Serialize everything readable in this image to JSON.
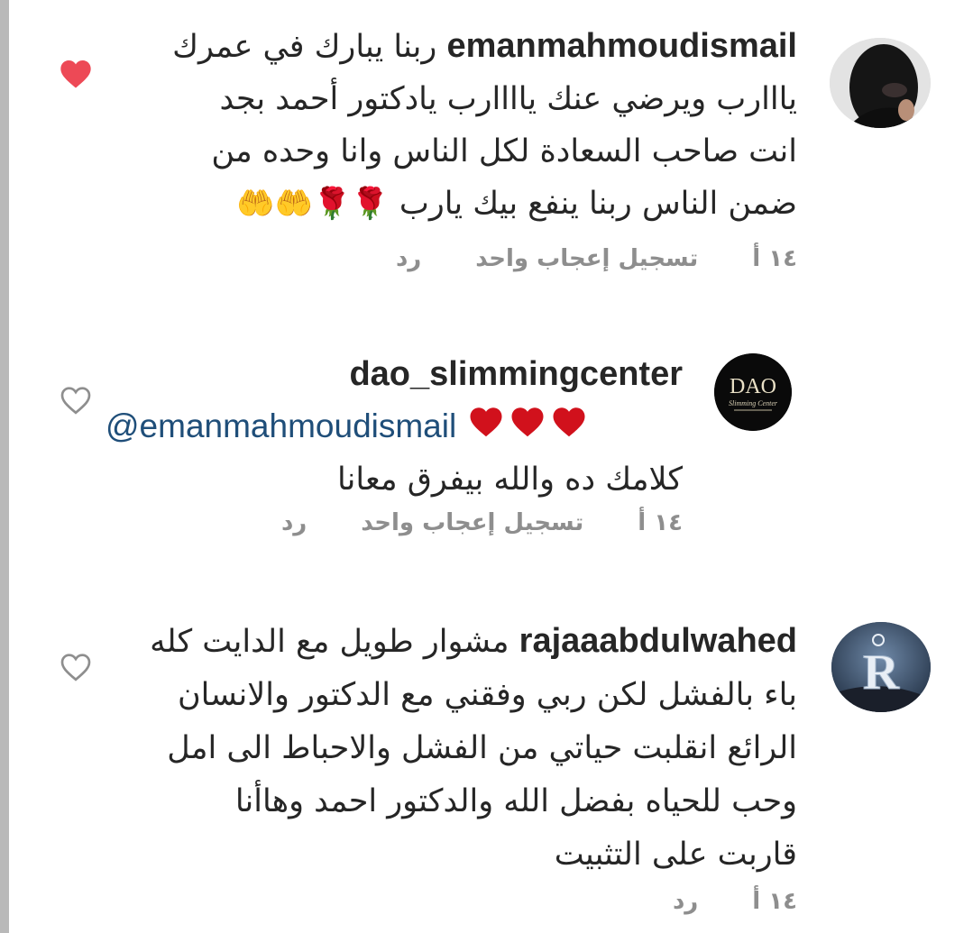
{
  "comments": [
    {
      "username": "emanmahmoudismail",
      "lines": [
        "ربنا يبارك في عمرك",
        "يااارب ويرضي عنك ياااارب يادكتور أحمد بجد",
        "انت صاحب السعادة لكل الناس وانا وحده من",
        "ضمن الناس ربنا ينفع بيك يارب"
      ],
      "emojis": "🌹🌹🤲🤲",
      "time": "١٤ أ",
      "likes": "تسجيل إعجاب واحد",
      "reply": "رد",
      "liked": true,
      "avatar_icon": "profile-photo-veiled-woman"
    },
    {
      "username": "dao_slimmingcenter",
      "mention": "@emanmahmoudismail",
      "hearts": "❤❤❤",
      "lines": [
        "كلامك ده والله بيفرق معانا"
      ],
      "time": "١٤ أ",
      "likes": "تسجيل إعجاب واحد",
      "reply": "رد",
      "liked": false,
      "avatar_text": "DAO",
      "avatar_subtext": "Slimming Center"
    },
    {
      "username": "rajaaabdulwahed",
      "lines": [
        "مشوار طويل مع الدايت كله",
        "باء بالفشل لكن ربي وفقني مع الدكتور والانسان",
        "الرائع انقلبت حياتي من الفشل والاحباط الى امل",
        "وحب للحياه بفضل الله والدكتور احمد وهاأنا",
        "قاربت على التثبيت"
      ],
      "time": "١٤ أ",
      "reply": "رد",
      "liked": false,
      "avatar_letter": "R"
    }
  ],
  "colors": {
    "like_red": "#ed4956",
    "heart_outline": "#8e8e8e",
    "mention_blue": "#1f4e79",
    "meta_gray": "#8e8e8e",
    "text": "#262626"
  }
}
